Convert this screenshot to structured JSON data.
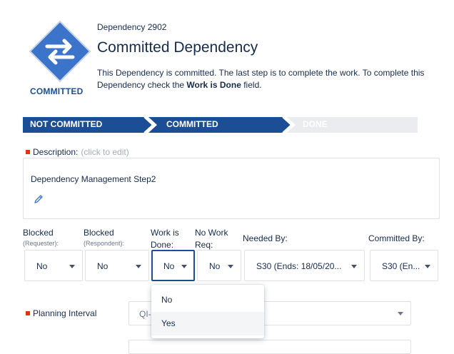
{
  "header": {
    "status_caption": "COMMITTED",
    "dependency_id": "Dependency 2902",
    "title": "Committed Dependency",
    "desc_part1": "This Dependency is committed. The last step is to complete the work. To complete this Dependency check the ",
    "desc_bold": "Work is Done",
    "desc_part2": " field.",
    "logo_color": "#3b74c9"
  },
  "progress": {
    "steps": [
      {
        "label": "NOT COMMITTED",
        "state": "done"
      },
      {
        "label": "COMMITTED",
        "state": "current"
      },
      {
        "label": "DONE",
        "state": "pending"
      }
    ],
    "active_color": "#1c4e95",
    "inactive_color": "#ebecf0"
  },
  "description": {
    "label": "Description:",
    "hint": "(click to edit)",
    "text": "Dependency Management Step2"
  },
  "fields": {
    "blocked_req": {
      "label": "Blocked",
      "sub": "(Requester):",
      "value": "No"
    },
    "blocked_resp": {
      "label": "Blocked",
      "sub": "(Respondent):",
      "value": "No"
    },
    "work_done": {
      "label": "Work is",
      "label2": "Done:",
      "value": "No"
    },
    "no_work": {
      "label": "No Work",
      "label2": "Req:",
      "value": "No"
    },
    "needed_by": {
      "label": "Needed By:",
      "value": "S30 (Ends: 18/05/20..."
    },
    "committed_by": {
      "label": "Committed By:",
      "value": "S30 (En..."
    }
  },
  "dropdown": {
    "options": [
      "No",
      "Yes"
    ],
    "hovered": "Yes"
  },
  "planning_interval": {
    "label": "Planning Interval",
    "value": "QI-"
  }
}
